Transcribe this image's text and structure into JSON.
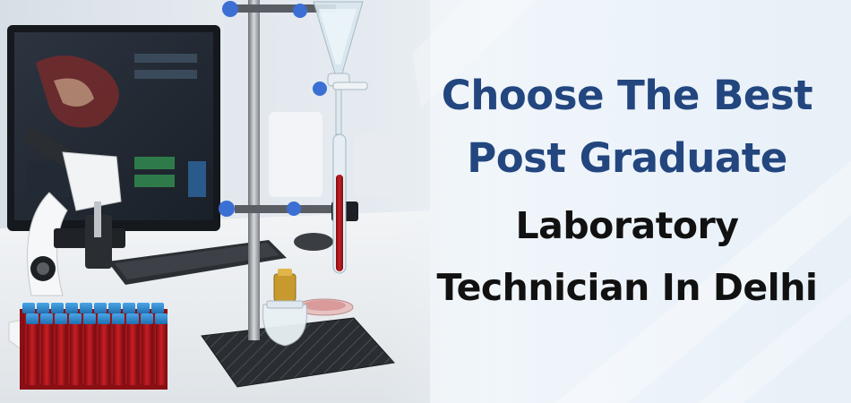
{
  "banner": {
    "headline_lines": [
      {
        "text": "Choose The Best",
        "color": "#23467f"
      },
      {
        "text": "Post Graduate",
        "color": "#23467f"
      },
      {
        "text": "Laboratory",
        "color": "#111111"
      },
      {
        "text": "Technician In Delhi",
        "color": "#111111"
      }
    ],
    "background_color": "#e9f1f8"
  },
  "scene": {
    "objects": [
      "computer-monitor",
      "microscope",
      "keyboard",
      "mouse",
      "retort-stand",
      "separatory-funnel",
      "burette-with-red-liquid",
      "alcohol-burner",
      "test-tube-rack",
      "petri-dish"
    ],
    "accent_color": "#3b6fd4",
    "liquid_color": "#b0151c"
  }
}
